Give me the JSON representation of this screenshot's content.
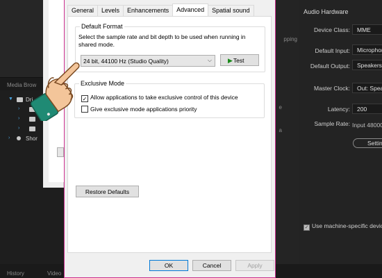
{
  "host": {
    "media_browser_label": "Media Brow",
    "tree_items": [
      "Dri",
      "",
      "",
      "",
      "Shor"
    ],
    "bottom_tabs": [
      "History",
      "Video"
    ],
    "mid_strip": [
      "pping",
      "e",
      "a"
    ]
  },
  "audio_panel": {
    "title": "Audio Hardware",
    "device_class_label": "Device Class:",
    "device_class_value": "MME",
    "default_input_label": "Default Input:",
    "default_input_value": "Microphon",
    "default_output_label": "Default Output:",
    "default_output_value": "Speakers /",
    "master_clock_label": "Master Clock:",
    "master_clock_value": "Out: Speak",
    "latency_label": "Latency:",
    "latency_value": "200",
    "sample_rate_label": "Sample Rate:",
    "sample_rate_value": "Input 48000",
    "settings_button": "Settin",
    "machine_specific_label": "Use machine-specific devic",
    "machine_specific_checked": true
  },
  "dialog": {
    "tabs": [
      "General",
      "Levels",
      "Enhancements",
      "Advanced",
      "Spatial sound"
    ],
    "active_tab": "Advanced",
    "default_format": {
      "title": "Default Format",
      "description": "Select the sample rate and bit depth to be used when running in shared mode.",
      "selected_format": "24 bit, 44100 Hz (Studio Quality)",
      "test_label": "Test"
    },
    "exclusive_mode": {
      "title": "Exclusive Mode",
      "allow_exclusive_label": "Allow applications to take exclusive control of this device",
      "allow_exclusive_checked": true,
      "priority_label": "Give exclusive mode applications priority",
      "priority_checked": false
    },
    "restore_defaults_label": "Restore Defaults",
    "ok_label": "OK",
    "cancel_label": "Cancel",
    "apply_label": "Apply"
  },
  "colors": {
    "dialog_border": "#cc2f90",
    "hand_cuff": "#1f8a74",
    "hand_skin": "#f3c59a",
    "test_play": "#1a8a1a"
  }
}
